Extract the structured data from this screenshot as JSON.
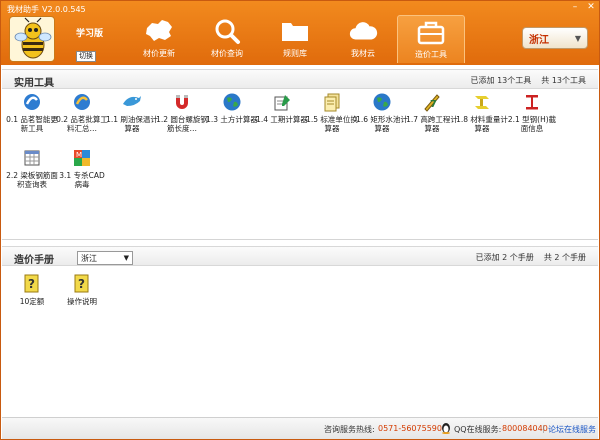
{
  "window": {
    "title": "我材助手",
    "version": "V2.0.0.545"
  },
  "header": {
    "edition": "学习版",
    "switch_link": "切换",
    "nav": [
      {
        "label": "材价更新",
        "icon": "china-map-icon",
        "active": false
      },
      {
        "label": "材价查询",
        "icon": "magnifier-icon",
        "active": false
      },
      {
        "label": "规则库",
        "icon": "folder-icon",
        "active": false
      },
      {
        "label": "我材云",
        "icon": "cloud-icon",
        "active": false
      },
      {
        "label": "造价工具",
        "icon": "toolbox-icon",
        "active": true
      }
    ],
    "region": "浙江"
  },
  "tools_section": {
    "title": "实用工具",
    "added_label": "已添加",
    "added_count": "13个工具",
    "total_label": "共",
    "total_count": "13个工具",
    "items": [
      {
        "label": "0.1 品茗智能更新工具",
        "icon": "blue-swirl-icon"
      },
      {
        "label": "0.2 品茗批算工料汇总…",
        "icon": "blue-swirl-icon"
      },
      {
        "label": "1.1 刷油保温计算器",
        "icon": "dolphin-icon"
      },
      {
        "label": "1.2 圆台螺旋钢筋长度…",
        "icon": "magnet-icon"
      },
      {
        "label": "1.3 土方计算器",
        "icon": "globe-icon"
      },
      {
        "label": "1.4 工期计算器",
        "icon": "calendar-pencil-icon"
      },
      {
        "label": "1.5 标准单位换算器",
        "icon": "documents-icon"
      },
      {
        "label": "1.6 矩形水池计算器",
        "icon": "globe-icon"
      },
      {
        "label": "1.7 高跨工程计算器",
        "icon": "pencil-ruler-icon"
      },
      {
        "label": "1.8 材料重量计算器",
        "icon": "ibeam-3d-icon"
      },
      {
        "label": "2.1 型钢(H)截面信息",
        "icon": "ibeam-icon"
      },
      {
        "label": "2.2 梁板钢筋面积查询表",
        "icon": "table-grid-icon"
      },
      {
        "label": "3.1 专杀CAD病毒",
        "icon": "cad-tools-icon"
      }
    ]
  },
  "manual_section": {
    "title": "造价手册",
    "region_value": "浙江",
    "added_label": "已添加",
    "added_count": "2 个手册",
    "total_label": "共",
    "total_count": "2 个手册",
    "items": [
      {
        "label": "10定额",
        "icon": "help-doc-icon"
      },
      {
        "label": "操作说明",
        "icon": "help-doc-icon"
      }
    ]
  },
  "footer": {
    "hotline_label": "咨询服务热线:",
    "hotline_number": "0571-56075590",
    "qq_label": "QQ在线服务:",
    "qq_number": "800084040",
    "forum_link": "论坛在线服务"
  },
  "colors": {
    "header": "#e87a14",
    "accent_red": "#d43b00",
    "link": "#1a56c6"
  }
}
